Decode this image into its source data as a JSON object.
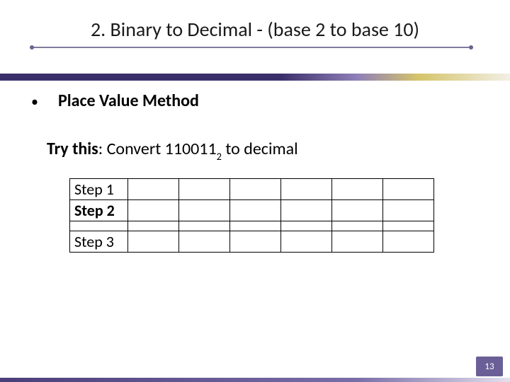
{
  "title": "2. Binary to Decimal - (base 2 to base 10)",
  "bullet": {
    "marker": "•",
    "text": "Place Value Method"
  },
  "trythis": {
    "label": "Try this",
    "colon": ": ",
    "body_pre": "Convert 110011",
    "subscript": "2",
    "body_post": " to decimal"
  },
  "table": {
    "rows": [
      {
        "label": "Step 1",
        "cells": [
          "",
          "",
          "",
          "",
          "",
          ""
        ]
      },
      {
        "label": "Step 2",
        "cells": [
          "",
          "",
          "",
          "",
          "",
          ""
        ]
      },
      {
        "label": "Step 3",
        "cells": [
          "",
          "",
          "",
          "",
          "",
          ""
        ]
      }
    ]
  },
  "page_number": "13"
}
